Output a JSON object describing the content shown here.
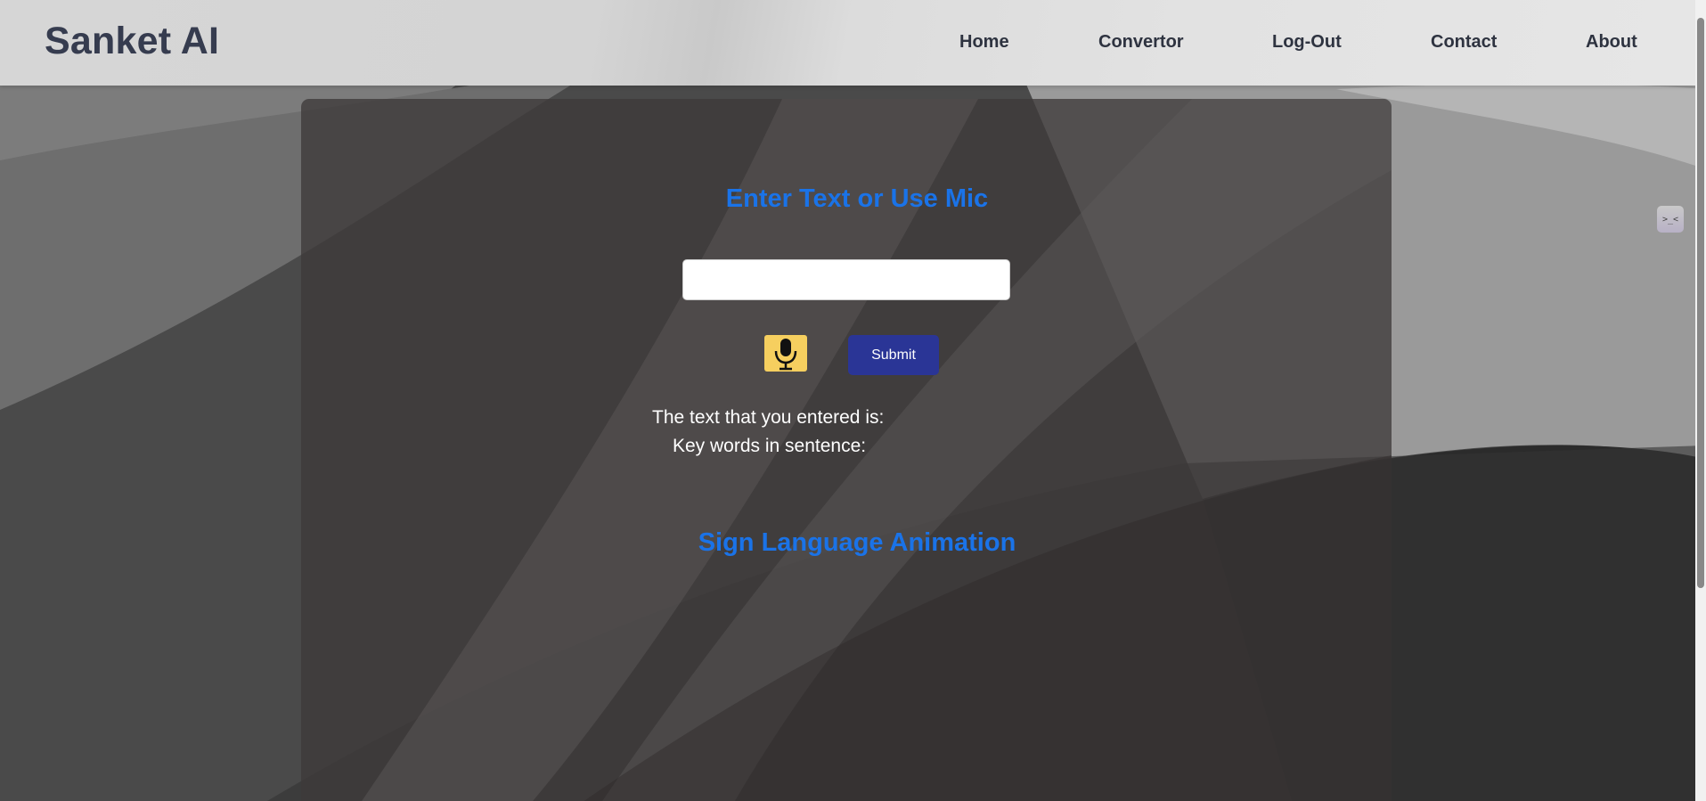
{
  "brand": {
    "title": "Sanket AI"
  },
  "nav": {
    "home": "Home",
    "convertor": "Convertor",
    "logout": "Log-Out",
    "contact": "Contact",
    "about": "About"
  },
  "main": {
    "heading_input": "Enter Text or Use Mic",
    "input_value": "",
    "mic_icon": "microphone-icon",
    "submit_label": "Submit",
    "entered_text_label": "The text that you entered is:",
    "keywords_label": "Key words in sentence:",
    "heading_animation": "Sign Language Animation"
  },
  "extension": {
    "icon_glyph": ">_<"
  },
  "colors": {
    "heading": "#1a73e8",
    "submit_bg": "#2a3596",
    "mic_bg": "#f6cf5f",
    "brand_text": "#363c4f"
  }
}
